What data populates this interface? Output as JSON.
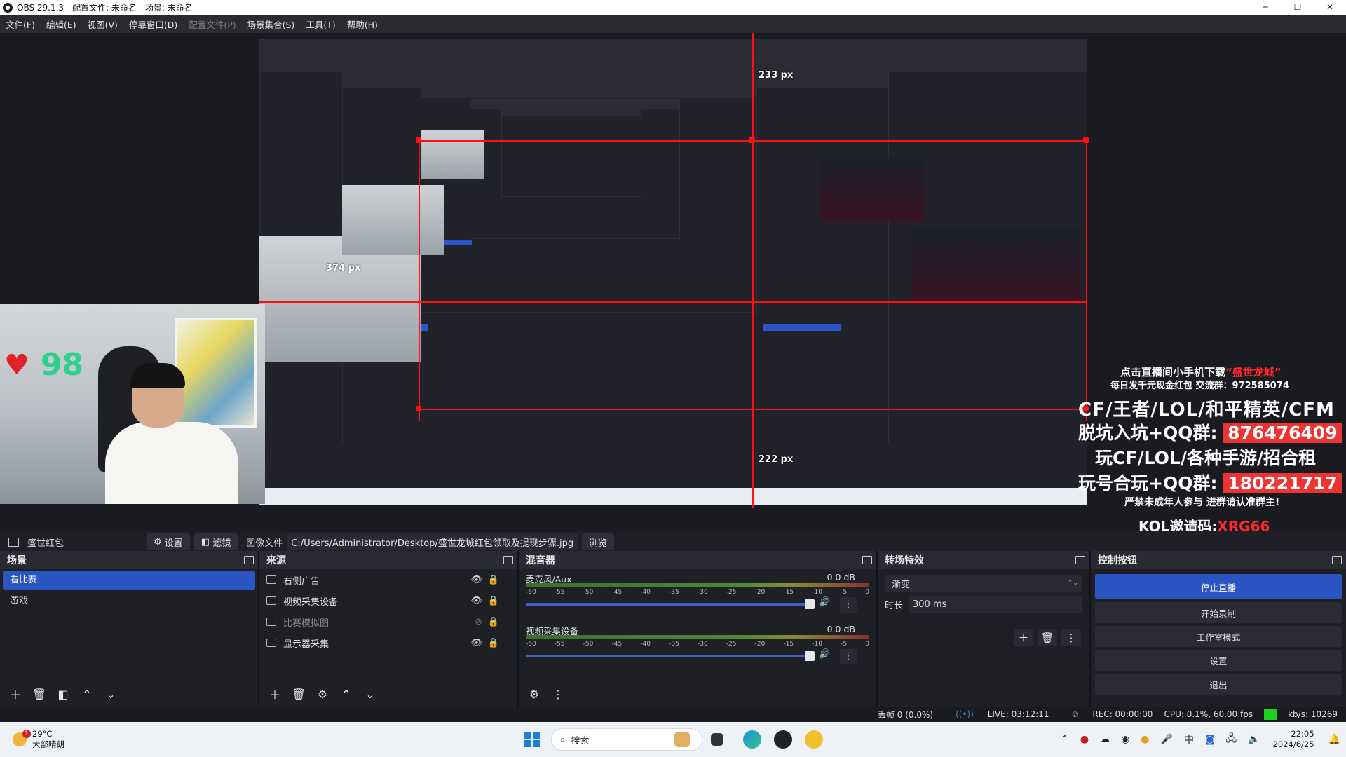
{
  "window": {
    "title": "OBS 29.1.3 - 配置文件: 未命名 - 场景: 未命名",
    "controls": [
      "─",
      "☐",
      "✕"
    ]
  },
  "menu": [
    {
      "label": "文件(F)",
      "disabled": false
    },
    {
      "label": "编辑(E)",
      "disabled": false
    },
    {
      "label": "视图(V)",
      "disabled": false
    },
    {
      "label": "停靠窗口(D)",
      "disabled": false
    },
    {
      "label": "配置文件(P)",
      "disabled": true
    },
    {
      "label": "场景集合(S)",
      "disabled": false
    },
    {
      "label": "工具(T)",
      "disabled": false
    },
    {
      "label": "帮助(H)",
      "disabled": false
    }
  ],
  "preview": {
    "px_top": "233 px",
    "px_left": "374 px",
    "px_bottom": "222 px",
    "likes": "98",
    "ad": {
      "line1_prefix": "点击直播间小手机下载",
      "line1_highlight": "“盛世龙城”",
      "line2": "每日发千元现金红包 交流群：972585074",
      "line3": "CF/王者/LOL/和平精英/CFM",
      "line4_label": "脱坑入坑+QQ群:",
      "line4_value": "876476409",
      "line5": "玩CF/LOL/各种手游/招合租",
      "line6_label": "玩号合玩+QQ群:",
      "line6_value": "180221717",
      "line7": "严禁未成年人参与 进群请认准群主!",
      "line8_prefix": "KOL邀请码:",
      "line8_code": "XRG66"
    }
  },
  "source_toolbar": {
    "source_name": "盛世红包",
    "settings_label": "设置",
    "filters_label": "滤镜",
    "image_file_label": "图像文件",
    "path": "C:/Users/Administrator/Desktop/盛世龙城红包领取及提现步骤.jpg",
    "browse_label": "浏览"
  },
  "scenes": {
    "title": "场景",
    "items": [
      "看比赛",
      "游戏"
    ],
    "active_index": 0
  },
  "sources": {
    "title": "来源",
    "items": [
      {
        "label": "右侧广告",
        "icon": "image-icon",
        "visible": true
      },
      {
        "label": "视频采集设备",
        "icon": "camera-icon",
        "visible": true
      },
      {
        "label": "比赛模拟图",
        "icon": "image-icon",
        "visible": false
      },
      {
        "label": "显示器采集",
        "icon": "monitor-icon",
        "visible": true
      }
    ]
  },
  "mixer": {
    "title": "混音器",
    "ticks": [
      "-60",
      "-55",
      "-50",
      "-45",
      "-40",
      "-35",
      "-30",
      "-25",
      "-20",
      "-15",
      "-10",
      "-5",
      "0"
    ],
    "channels": [
      {
        "name": "麦克风/Aux",
        "db": "0.0 dB"
      },
      {
        "name": "视频采集设备",
        "db": "0.0 dB"
      }
    ]
  },
  "transitions": {
    "title": "转场特效",
    "selected": "渐变",
    "duration_label": "时长",
    "duration_value": "300 ms"
  },
  "controls": {
    "title": "控制按钮",
    "buttons": [
      "停止直播",
      "开始录制",
      "工作室模式",
      "设置",
      "退出"
    ]
  },
  "status": {
    "dropped": "丢帧 0 (0.0%)",
    "live": "LIVE: 03:12:11",
    "rec": "REC: 00:00:00",
    "cpu": "CPU: 0.1%, 60.00 fps",
    "bitrate": "kb/s: 10269"
  },
  "taskbar": {
    "weather_temp": "29°C",
    "weather_desc": "大部晴朗",
    "weather_badge": "1",
    "search_placeholder": "搜索",
    "time": "22:05",
    "date": "2024/6/25"
  }
}
